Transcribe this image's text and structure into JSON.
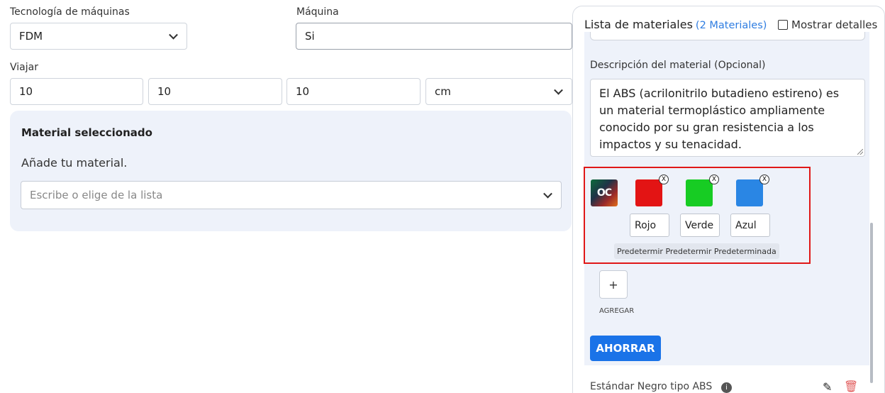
{
  "left": {
    "tech_label": "Tecnología de máquinas",
    "tech_value": "FDM",
    "machine_label": "Máquina",
    "machine_value": "Si",
    "travel_label": "Viajar",
    "travel_x": "10",
    "travel_y": "10",
    "travel_z": "10",
    "unit_value": "cm",
    "material_card": {
      "title": "Material seleccionado",
      "add_text": "Añade tu material.",
      "select_placeholder": "Escribe o elige de la lista"
    }
  },
  "panel": {
    "title": "Lista de materiales",
    "count": "(2 Materiales)",
    "show_details_label": "Mostrar detalles",
    "desc_label": "Descripción del material (Opcional)",
    "desc_text": "El ABS (acrilonitrilo butadieno estireno) es un material termoplástico ampliamente conocido por su gran resistencia a los impactos y su tenacidad.",
    "logo_text": "OC",
    "colors": [
      {
        "name": "Rojo",
        "hex": "#e31414"
      },
      {
        "name": "Verde",
        "hex": "#17cc23"
      },
      {
        "name": "Azul",
        "hex": "#2a86e4"
      }
    ],
    "close_glyph": "X",
    "default_badge": "Predetermir Predetermir Predeterminada",
    "add_symbol": "+",
    "add_label": "AGREGAR",
    "save_label": "AHORRAR",
    "bottom_item": "Estándar Negro tipo ABS",
    "info_glyph": "i",
    "accent_color": "#1a73e8"
  }
}
